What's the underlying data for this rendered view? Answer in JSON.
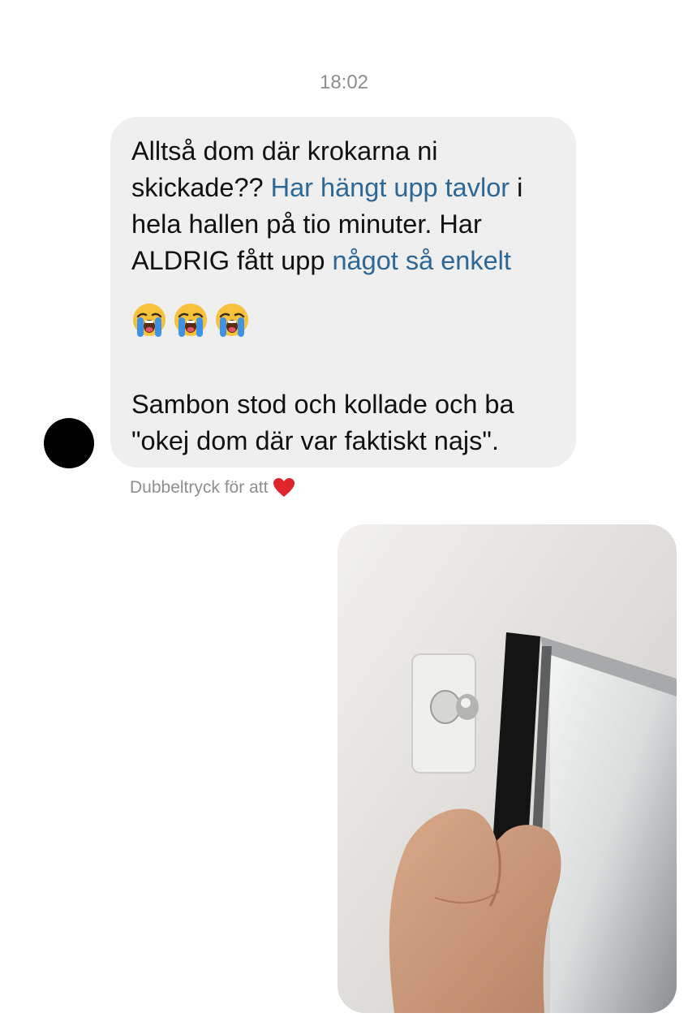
{
  "thread": {
    "timestamp": "18:02"
  },
  "message": {
    "p1_a": "Alltså dom där krokarna ni skickade?? ",
    "p1_link": "Har hängt upp tavlor",
    "p1_b": " i hela hallen på tio minuter. Har ALDRIG fått upp ",
    "p1_link2": "något så enkelt",
    "emojis": [
      "loudly-crying-face",
      "loudly-crying-face",
      "loudly-crying-face"
    ],
    "p2": "Sambon stod och kollade och ba \"okej dom där var faktiskt najs\"."
  },
  "hint": {
    "text": "Dubbeltryck för att",
    "icon": "heart-icon"
  },
  "colors": {
    "bubble_bg": "#efefef",
    "link": "#2d6796",
    "muted": "#8e8e93",
    "heart": "#e0242c"
  }
}
